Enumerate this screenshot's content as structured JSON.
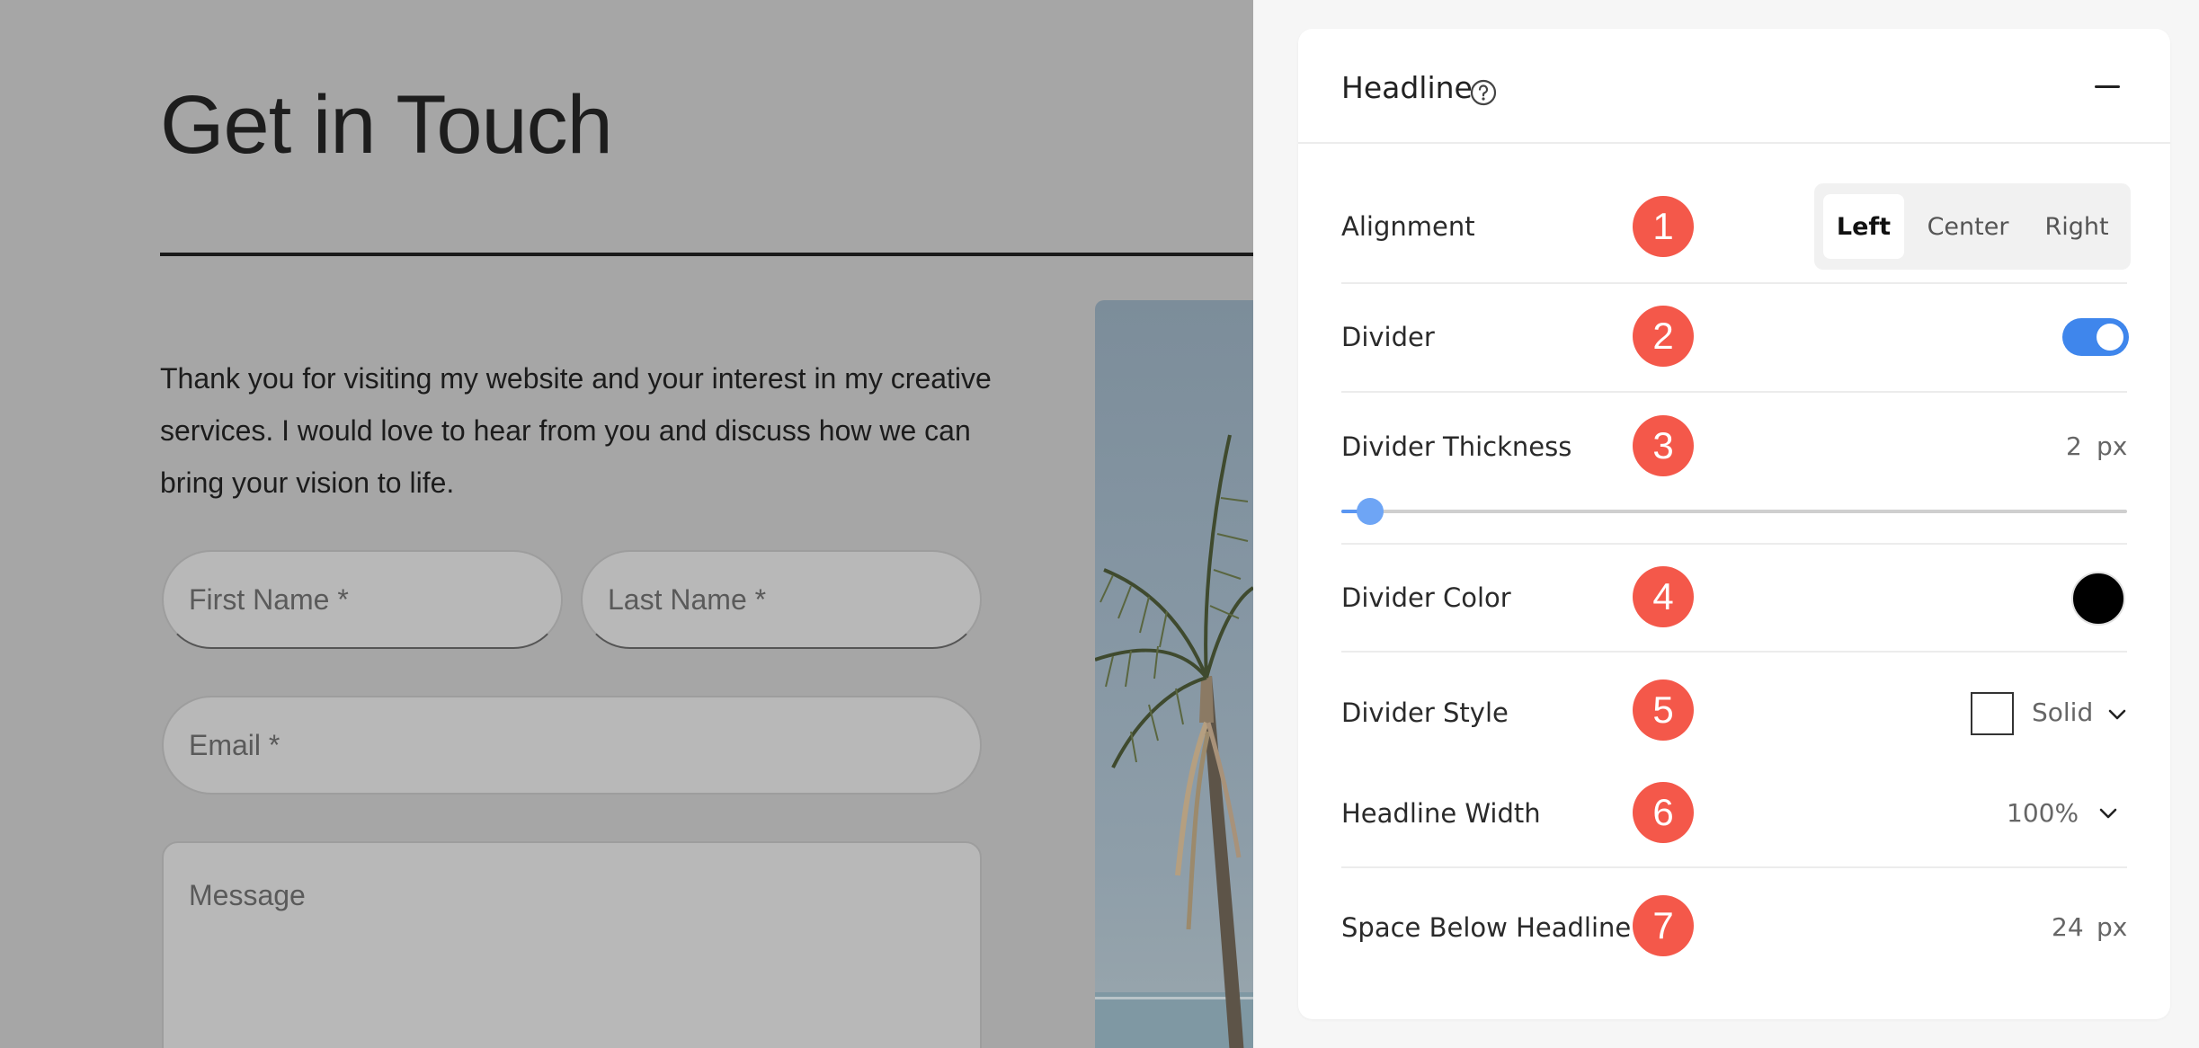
{
  "preview": {
    "title": "Get in Touch",
    "intro": "Thank you for visiting my website and your interest in my creative services. I would love to hear from you and discuss how we can bring your vision to life.",
    "form": {
      "first_name_placeholder": "First Name *",
      "last_name_placeholder": "Last Name *",
      "email_placeholder": "Email *",
      "message_placeholder": "Message"
    }
  },
  "panel": {
    "title": "Headline",
    "rows": {
      "alignment": {
        "label": "Alignment",
        "badge": "1",
        "options": [
          "Left",
          "Center",
          "Right"
        ],
        "selected": "Left"
      },
      "divider": {
        "label": "Divider",
        "badge": "2",
        "enabled": true
      },
      "thickness": {
        "label": "Divider Thickness",
        "badge": "3",
        "value": "2",
        "unit": "px",
        "slider_fraction": 0.02
      },
      "color": {
        "label": "Divider Color",
        "badge": "4",
        "value": "#000000"
      },
      "style": {
        "label": "Divider Style",
        "badge": "5",
        "value": "Solid"
      },
      "width": {
        "label": "Headline Width",
        "badge": "6",
        "value": "100%"
      },
      "space": {
        "label": "Space Below Headline",
        "badge": "7",
        "value": "24",
        "unit": "px"
      }
    }
  },
  "colors": {
    "accent": "#3f86ec",
    "badge": "#f4584a",
    "overlay": "#a6a6a6"
  },
  "icons": [
    "help-circle-icon",
    "minus-icon",
    "chevron-down-icon"
  ]
}
